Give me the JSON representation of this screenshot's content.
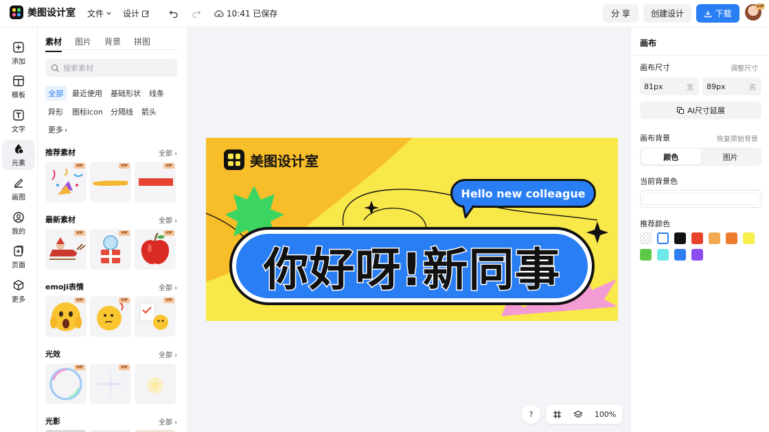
{
  "app": {
    "name": "美图设计室"
  },
  "topbar": {
    "file_menu": "文件",
    "design_menu": "设计",
    "save_status": "10:41 已保存",
    "share": "分 享",
    "create": "创建设计",
    "download": "下载",
    "avatar_badge": "VIP"
  },
  "rail": [
    {
      "label": "添加",
      "icon": "plus-square-icon"
    },
    {
      "label": "模板",
      "icon": "template-icon"
    },
    {
      "label": "文字",
      "icon": "text-icon"
    },
    {
      "label": "元素",
      "icon": "shapes-icon"
    },
    {
      "label": "画图",
      "icon": "pen-icon"
    },
    {
      "label": "我的",
      "icon": "user-icon"
    },
    {
      "label": "页面",
      "icon": "page-add-icon"
    },
    {
      "label": "更多",
      "icon": "cube-icon"
    }
  ],
  "library": {
    "tabs": [
      "素材",
      "图片",
      "背景",
      "拼图"
    ],
    "search_placeholder": "搜索素材",
    "chips": [
      "全部",
      "最近使用",
      "基础形状",
      "线条",
      "异形",
      "图标icon",
      "分隔线",
      "箭头",
      "更多"
    ],
    "sections": [
      {
        "title": "推荐素材",
        "more": "全部"
      },
      {
        "title": "最新素材",
        "more": "全部"
      },
      {
        "title": "emoji表情",
        "more": "全部"
      },
      {
        "title": "光效",
        "more": "全部"
      },
      {
        "title": "光影",
        "more": "全部"
      }
    ],
    "vip_badge": "VIP"
  },
  "design": {
    "brand": "美图设计室",
    "bubble": "Hello new colleague",
    "headline": "你好呀!新同事"
  },
  "bottom_tools": {
    "help": "?",
    "zoom": "100%"
  },
  "props": {
    "title": "画布",
    "size_label": "画布尺寸",
    "adjust_size": "调整尺寸",
    "width_value": "81px",
    "width_unit": "宽",
    "height_value": "89px",
    "height_unit": "高",
    "ai_extend": "AI尺寸延展",
    "bg_label": "画布背景",
    "restore_bg": "恢复原始背景",
    "bg_tabs": [
      "颜色",
      "图片"
    ],
    "current_bg_label": "当前背景色",
    "recommended_label": "推荐颜色",
    "colors": [
      "transparent",
      "#ffffff",
      "#111111",
      "#e8412c",
      "#f2a950",
      "#ee7a2e",
      "#f6ef4c",
      "#5ec84a",
      "#6ee9e9",
      "#2f7ef0",
      "#8d4cf0"
    ]
  }
}
